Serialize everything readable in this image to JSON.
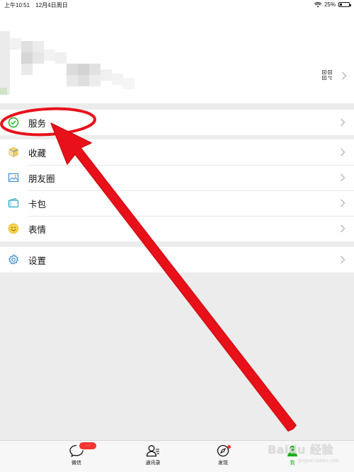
{
  "status_bar": {
    "time": "上午10:51",
    "date": "12月4日周日",
    "battery": "25%",
    "battery_level": 0.25
  },
  "menu": {
    "service": "服务",
    "favorites": "收藏",
    "moments": "朋友圈",
    "cards": "卡包",
    "stickers": "表情",
    "settings": "设置"
  },
  "tabbar": {
    "chats": "微信",
    "chats_badge": "···",
    "contacts": "通讯录",
    "discover": "发现",
    "me": "我"
  },
  "colors": {
    "accent_green": "#1aad19",
    "badge_red": "#f43530",
    "annotation_red": "#e8111a"
  },
  "icons": {
    "service": "service-check-icon",
    "favorites": "cube-icon",
    "moments": "picture-icon",
    "cards": "wallet-icon",
    "stickers": "smiley-icon",
    "settings": "gear-icon"
  },
  "watermark": {
    "brand": "Baidu 经验",
    "url": "jingyan.baidu.com"
  }
}
